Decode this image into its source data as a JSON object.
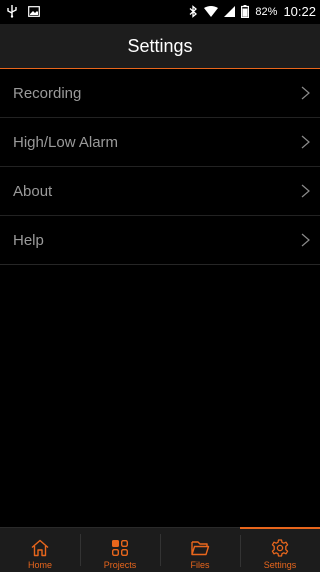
{
  "status_bar": {
    "battery_percent": "82%",
    "time": "10:22"
  },
  "app_bar": {
    "title": "Settings"
  },
  "settings": {
    "items": [
      {
        "label": "Recording"
      },
      {
        "label": "High/Low Alarm"
      },
      {
        "label": "About"
      },
      {
        "label": "Help"
      }
    ]
  },
  "tabs": {
    "items": [
      {
        "label": "Home",
        "icon": "home-icon"
      },
      {
        "label": "Projects",
        "icon": "grid-icon"
      },
      {
        "label": "Files",
        "icon": "folder-icon"
      },
      {
        "label": "Settings",
        "icon": "gear-icon"
      }
    ],
    "active": "Settings"
  },
  "colors": {
    "accent": "#e8661c",
    "background": "#000000",
    "bar": "#1d1d1d",
    "item_text": "#9a9a9a"
  }
}
